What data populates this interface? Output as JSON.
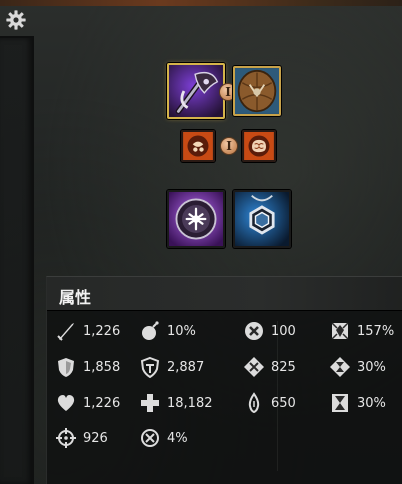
{
  "toolbar": {
    "settings_icon": "gear-icon"
  },
  "equipment": {
    "weapon_set_1": {
      "main_hand": "purple-axe-icon",
      "off_hand": "wooden-shield-icon",
      "swap_label": "I"
    },
    "weapon_set_2": {
      "main_hand": "orange-sigil-icon",
      "off_hand": "orange-brain-sigil-icon",
      "swap_label": "I"
    },
    "extras": [
      "purple-rune-icon",
      "blue-amulet-icon"
    ]
  },
  "attributes": {
    "title": "属性",
    "column1": [
      {
        "icon": "sword-icon",
        "value": "1,226"
      },
      {
        "icon": "shield-icon",
        "value": "1,858"
      },
      {
        "icon": "heart-icon",
        "value": "1,226"
      },
      {
        "icon": "crosshair-icon",
        "value": "926"
      }
    ],
    "column2": [
      {
        "icon": "bomb-icon",
        "value": "10%"
      },
      {
        "icon": "toughness-shield-icon",
        "value": "2,887"
      },
      {
        "icon": "cross-icon",
        "value": "18,182"
      },
      {
        "icon": "target-burst-icon",
        "value": "4%"
      }
    ],
    "column3": [
      {
        "icon": "x-circle-icon",
        "value": "100"
      },
      {
        "icon": "diamond-cross-icon",
        "value": "825"
      },
      {
        "icon": "flame-drop-icon",
        "value": "650"
      }
    ],
    "column4": [
      {
        "icon": "boon-burst-icon",
        "value": "157%"
      },
      {
        "icon": "condition-hourglass-icon",
        "value": "30%"
      },
      {
        "icon": "hourglass-icon",
        "value": "30%"
      }
    ]
  }
}
